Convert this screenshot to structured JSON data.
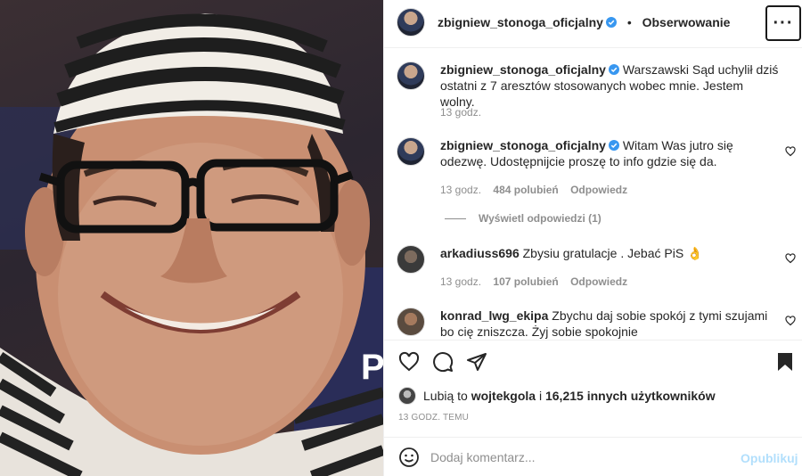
{
  "post": {
    "username": "zbigniew_stonoga_oficjalny",
    "separator": "•",
    "follow_label": "Obserwowanie",
    "more_label": "···",
    "photo_edge_letter": "P"
  },
  "comments": [
    {
      "username": "zbigniew_stonoga_oficjalny",
      "verified": true,
      "text": "Warszawski Sąd uchylił dziś ostatni z 7 aresztów stosowanych wobec mnie. Jestem wolny.",
      "time": "13 godz.",
      "likes": "",
      "reply": ""
    },
    {
      "username": "zbigniew_stonoga_oficjalny",
      "verified": true,
      "text": "Witam Was jutro się odezwę. Udostępnijcie proszę to info gdzie się da.",
      "time": "13 godz.",
      "likes": "484 polubień",
      "reply": "Odpowiedz"
    },
    {
      "username": "arkadiuss696",
      "verified": false,
      "text": "Zbysiu gratulacje . Jebać PiS 👌",
      "time": "13 godz.",
      "likes": "107 polubień",
      "reply": "Odpowiedz"
    },
    {
      "username": "konrad_lwg_ekipa",
      "verified": false,
      "text": "Zbychu daj sobie spokój z tymi szujami bo cię zniszcza. Żyj sobie spokojnie",
      "time": "",
      "likes": "",
      "reply": ""
    }
  ],
  "view_replies": "Wyświetl odpowiedzi (1)",
  "likes_line": {
    "prefix": "Lubią to",
    "user": "wojtekgola",
    "middle": "i",
    "others": "16,215 innych użytkowników"
  },
  "timestamp": "13 godz. temu",
  "add_comment": {
    "placeholder": "Dodaj komentarz...",
    "post_label": "Opublikuj"
  },
  "icons": {
    "like": "heart-icon",
    "comment": "comment-bubble-icon",
    "share": "paper-plane-icon",
    "save": "bookmark-icon",
    "emoji": "emoji-smile-icon",
    "verified": "verified-badge-icon"
  },
  "colors": {
    "verified_blue": "#3897f0",
    "muted_text": "#8e8e8e",
    "post_button_disabled": "#b2dffc"
  }
}
